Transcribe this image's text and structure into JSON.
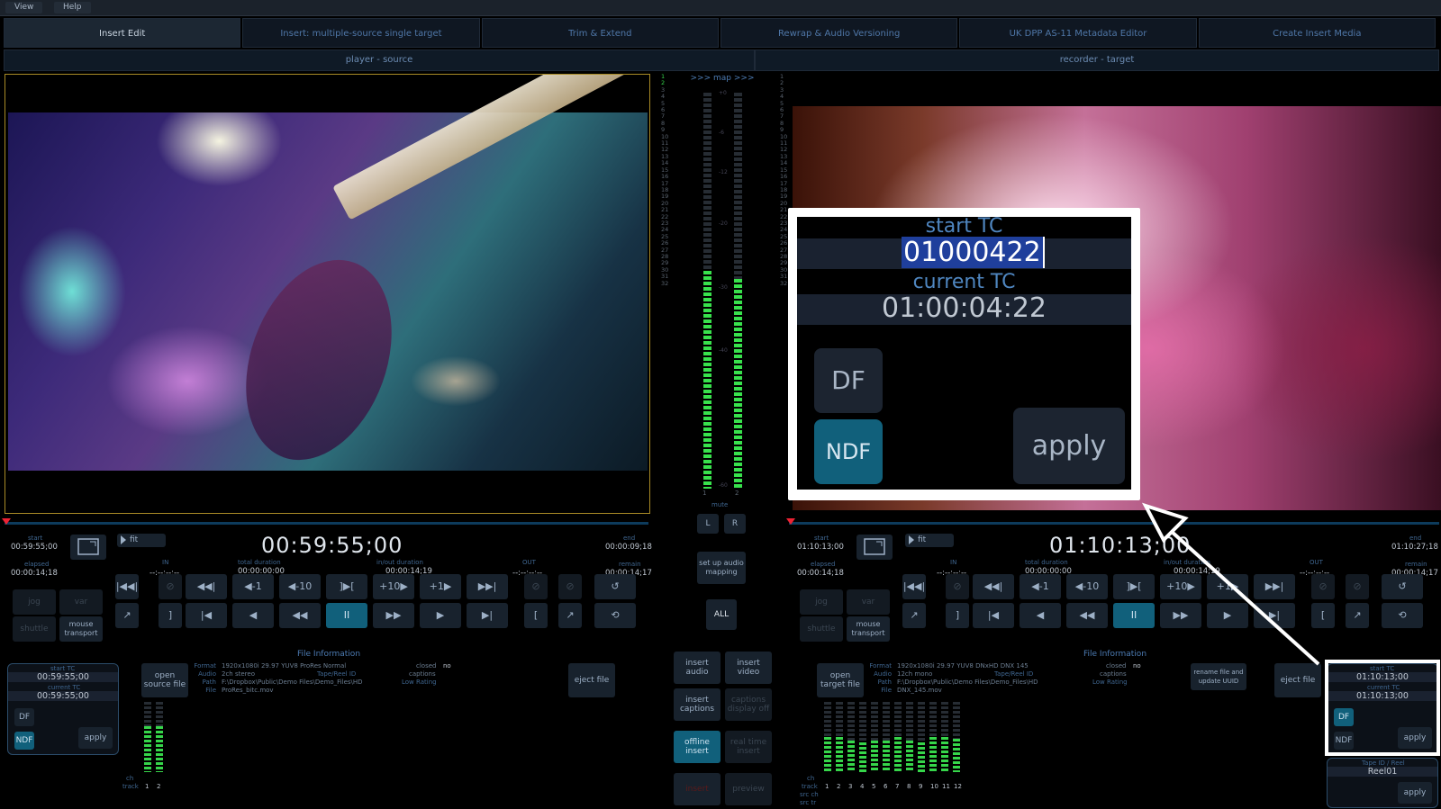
{
  "menu": {
    "items": [
      "View",
      "Help"
    ]
  },
  "tabs": [
    {
      "label": "Insert Edit",
      "active": true
    },
    {
      "label": "Insert: multiple-source single target",
      "active": false
    },
    {
      "label": "Trim & Extend",
      "active": false
    },
    {
      "label": "Rewrap & Audio Versioning",
      "active": false
    },
    {
      "label": "UK DPP AS-11 Metadata Editor",
      "active": false
    },
    {
      "label": "Create Insert Media",
      "active": false
    }
  ],
  "subbars": {
    "player": "player - source",
    "recorder": "recorder - target"
  },
  "mapbar": {
    "label": ">>> map >>>",
    "mute": "mute",
    "L": "L",
    "R": "R",
    "setup": "set up audio mapping",
    "all": "ALL"
  },
  "meter_scale": [
    "+0",
    "-6",
    "-12",
    "-20",
    "-30",
    "-40",
    "-60"
  ],
  "meter_levels": {
    "left": 0.55,
    "right": 0.53
  },
  "channel_numbers": [
    "1",
    "2",
    "3",
    "4",
    "5",
    "6",
    "7",
    "8",
    "9",
    "10",
    "11",
    "12",
    "13",
    "14",
    "15",
    "16",
    "17",
    "18",
    "19",
    "20",
    "21",
    "22",
    "23",
    "24",
    "25",
    "26",
    "27",
    "28",
    "29",
    "30",
    "31",
    "32"
  ],
  "meter_bottom": [
    "1",
    "2"
  ],
  "player": {
    "start_label": "start",
    "start_tc": "00:59:55;00",
    "elapsed_label": "elapsed",
    "elapsed_tc": "00:00:14;18",
    "fit": "fit",
    "timecode": "00:59:55;00",
    "in_label": "IN",
    "in_value": "--:--:--:--",
    "total_label": "total duration",
    "total_value": "00:00:00:00",
    "inout_label": "in/out duration",
    "inout_value": "00:00:14;19",
    "out_label": "OUT",
    "out_value": "--:--:--:--",
    "end_label": "end",
    "end_tc": "00:00:09;18",
    "remain_label": "remain",
    "remain_tc": "00:00:14;17",
    "jog": "jog",
    "var": "var",
    "shuttle": "shuttle",
    "mouse": "mouse transport",
    "tc_panel": {
      "start_label": "start TC",
      "start": "00:59:55;00",
      "current_label": "current TC",
      "current": "00:59:55;00",
      "df": "DF",
      "ndf": "NDF",
      "apply": "apply"
    },
    "open_file": "open source file",
    "eject": "eject file",
    "file_info_title": "File Information",
    "format": "1920x1080i 29.97 YUV8 ProRes Normal",
    "audio": "2ch stereo",
    "path": "F:\\Dropbox\\Public\\Demo Files\\Demo_Files\\HD",
    "file": "ProRes_bitc.mov",
    "closed_label": "closed",
    "closed": "no",
    "captions_label": "captions",
    "tapereel_label": "Tape/Reel ID",
    "lowrating_label": "Low Rating",
    "ch_label": "ch",
    "track_label": "track",
    "channels": [
      "1",
      "2"
    ],
    "channel_levels": [
      0.66,
      0.66
    ]
  },
  "recorder": {
    "start_label": "start",
    "start_tc": "01:10:13;00",
    "elapsed_label": "elapsed",
    "elapsed_tc": "00:00:14;18",
    "fit": "fit",
    "timecode": "01:10:13;00",
    "in_label": "IN",
    "in_value": "--:--:--:--",
    "total_label": "total duration",
    "total_value": "00:00:00:00",
    "inout_label": "in/out duration",
    "inout_value": "00:00:14;19",
    "out_label": "OUT",
    "out_value": "--:--:--:--",
    "end_label": "end",
    "end_tc": "01:10:27;18",
    "remain_label": "remain",
    "remain_tc": "00:00:14;17",
    "jog": "jog",
    "var": "var",
    "shuttle": "shuttle",
    "mouse": "mouse transport",
    "tc_panel": {
      "start_label": "start TC",
      "start": "01:10:13;00",
      "current_label": "current TC",
      "current": "01:10:13;00",
      "df": "DF",
      "ndf": "NDF",
      "apply": "apply"
    },
    "tape_panel": {
      "label": "Tape ID / Reel",
      "value": "Reel01",
      "apply": "apply"
    },
    "open_file": "open target file",
    "rename": "rename file and update UUID",
    "eject": "eject file",
    "file_info_title": "File Information",
    "format": "1920x1080i 29.97 YUV8 DNxHD DNX 145",
    "audio": "12ch mono",
    "path": "F:\\Dropbox\\Public\\Demo Files\\Demo_Files\\HD",
    "file": "DNX_145.mov",
    "closed_label": "closed",
    "closed": "no",
    "captions_label": "captions",
    "tapereel_label": "Tape/Reel ID",
    "lowrating_label": "Low Rating",
    "ch_label": "ch",
    "track_label": "track",
    "srcch_label": "src ch",
    "srctr_label": "src tr",
    "channels": [
      "1",
      "2",
      "3",
      "4",
      "5",
      "6",
      "7",
      "8",
      "9",
      "10",
      "11",
      "12"
    ],
    "channel_levels": [
      0.5,
      0.5,
      0.45,
      0.42,
      0.45,
      0.45,
      0.5,
      0.45,
      0.42,
      0.5,
      0.5,
      0.48
    ]
  },
  "transport": {
    "row1": [
      "|◀◀|",
      "⊘",
      "◀◀|",
      "◀-1",
      "◀-10",
      "]▶[",
      "+10▶",
      "+1▶",
      "▶▶|",
      "⊘",
      "⊘",
      "↺"
    ],
    "row2": [
      "↗",
      "]",
      "|◀",
      "◀",
      "◀◀",
      "II",
      "▶▶",
      "▶",
      "▶|",
      "[",
      "↗",
      "⟲"
    ]
  },
  "center": {
    "insert_audio": "insert audio",
    "insert_video": "insert video",
    "insert_captions": "insert captions",
    "captions_off": "captions display off",
    "offline_insert": "offline insert",
    "realtime_insert": "real time insert",
    "insert": "insert",
    "preview": "preview"
  },
  "callout": {
    "start_label": "start TC",
    "start_value": "01000422",
    "current_label": "current TC",
    "current_value": "01:00:04:22",
    "df": "DF",
    "ndf": "NDF",
    "apply": "apply"
  },
  "colors": {
    "accent": "#11607b",
    "meter_green": "#38e14c",
    "tab_text": "#4f77a8",
    "highlight": "#ffffff"
  }
}
